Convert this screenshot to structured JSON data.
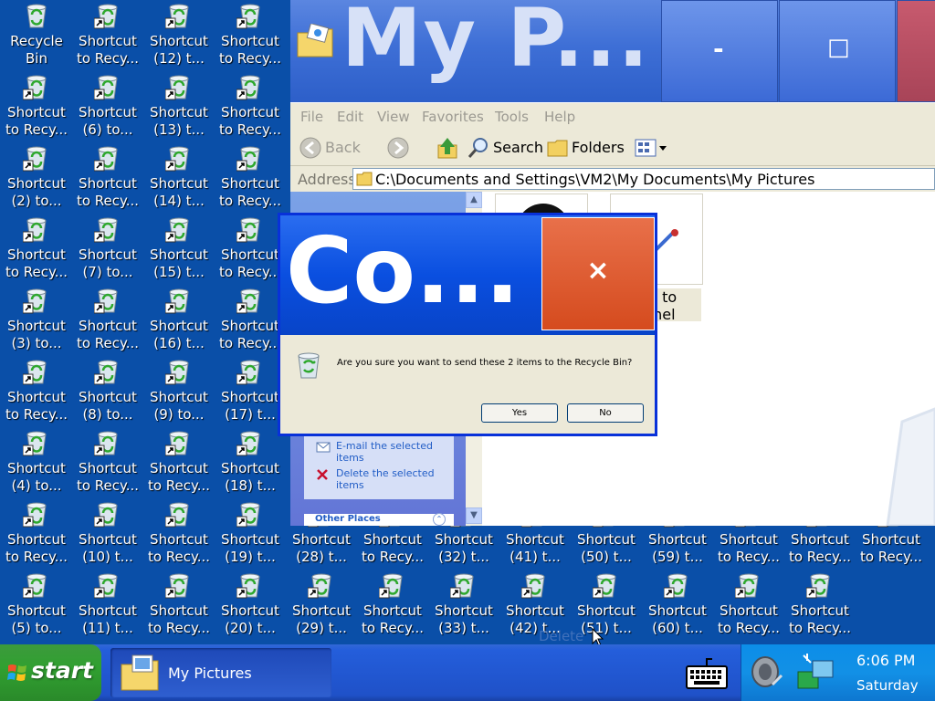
{
  "desktop": {
    "icons": [
      {
        "label1": "Recycle",
        "label2": "Bin"
      },
      {
        "label1": "Shortcut",
        "label2": "to Recy..."
      },
      {
        "label1": "Shortcut",
        "label2": "(12) t..."
      },
      {
        "label1": "Shortcut",
        "label2": "to Recy..."
      },
      {
        "label1": "Shortcut",
        "label2": "to Recy..."
      },
      {
        "label1": "Shortcut",
        "label2": "(6) to..."
      },
      {
        "label1": "Shortcut",
        "label2": "(13) t..."
      },
      {
        "label1": "Shortcut",
        "label2": "to Recy..."
      },
      {
        "label1": "Shortcut",
        "label2": "(2) to..."
      },
      {
        "label1": "Shortcut",
        "label2": "to Recy..."
      },
      {
        "label1": "Shortcut",
        "label2": "(14) t..."
      },
      {
        "label1": "Shortcut",
        "label2": "to Recy..."
      },
      {
        "label1": "Shortcut",
        "label2": "to Recy..."
      },
      {
        "label1": "Shortcut",
        "label2": "(7) to..."
      },
      {
        "label1": "Shortcut",
        "label2": "(15) t..."
      },
      {
        "label1": "Shortcut",
        "label2": "to Recy..."
      },
      {
        "label1": "Shortcut",
        "label2": "(3) to..."
      },
      {
        "label1": "Shortcut",
        "label2": "to Recy..."
      },
      {
        "label1": "Shortcut",
        "label2": "(16) t..."
      },
      {
        "label1": "Shortcut",
        "label2": "to Recy..."
      },
      {
        "label1": "Shortcut",
        "label2": "to Recy..."
      },
      {
        "label1": "Shortcut",
        "label2": "(8) to..."
      },
      {
        "label1": "Shortcut",
        "label2": "(9) to..."
      },
      {
        "label1": "Shortcut",
        "label2": "(17) t..."
      },
      {
        "label1": "Shortcut",
        "label2": "(4) to..."
      },
      {
        "label1": "Shortcut",
        "label2": "to Recy..."
      },
      {
        "label1": "Shortcut",
        "label2": "to Recy..."
      },
      {
        "label1": "Shortcut",
        "label2": "(18) t..."
      },
      {
        "label1": "Shortcut",
        "label2": "to Recy..."
      },
      {
        "label1": "Shortcut",
        "label2": "(10) t..."
      },
      {
        "label1": "Shortcut",
        "label2": "to Recy..."
      },
      {
        "label1": "Shortcut",
        "label2": "(19) t..."
      },
      {
        "label1": "Shortcut",
        "label2": "(28) t..."
      },
      {
        "label1": "Shortcut",
        "label2": "to Recy..."
      },
      {
        "label1": "Shortcut",
        "label2": "(32) t..."
      },
      {
        "label1": "Shortcut",
        "label2": "(41) t..."
      },
      {
        "label1": "Shortcut",
        "label2": "(50) t..."
      },
      {
        "label1": "Shortcut",
        "label2": "(59) t..."
      },
      {
        "label1": "Shortcut",
        "label2": "to Recy..."
      },
      {
        "label1": "Shortcut",
        "label2": "to Recy..."
      },
      {
        "label1": "Shortcut",
        "label2": "to Recy..."
      },
      {
        "label1": "Shortcut",
        "label2": "(5) to..."
      },
      {
        "label1": "Shortcut",
        "label2": "(11) t..."
      },
      {
        "label1": "Shortcut",
        "label2": "to Recy..."
      },
      {
        "label1": "Shortcut",
        "label2": "(20) t..."
      },
      {
        "label1": "Shortcut",
        "label2": "(29) t..."
      },
      {
        "label1": "Shortcut",
        "label2": "to Recy..."
      },
      {
        "label1": "Shortcut",
        "label2": "(33) t..."
      },
      {
        "label1": "Shortcut",
        "label2": "(42) t..."
      },
      {
        "label1": "Shortcut",
        "label2": "(51) t..."
      },
      {
        "label1": "Shortcut",
        "label2": "(60) t..."
      },
      {
        "label1": "Shortcut",
        "label2": "to Recy..."
      },
      {
        "label1": "Shortcut",
        "label2": "to Recy..."
      }
    ]
  },
  "explorer": {
    "title": "My P...",
    "minimize_glyph": "-",
    "maximize_glyph": "□",
    "menu": [
      "File",
      "Edit",
      "View",
      "Favorites",
      "Tools",
      "Help"
    ],
    "toolbar": {
      "back": "Back",
      "search": "Search",
      "folders": "Folders"
    },
    "address_label": "Address",
    "address_value": "C:\\Documents and Settings\\VM2\\My Documents\\My Pictures",
    "tasks": {
      "email": "E-mail the selected items",
      "delete": "Delete the selected items",
      "other_places": "Other Places"
    },
    "file_item_partial": [
      "cut to",
      "Panel"
    ]
  },
  "dialog": {
    "title": "Co...",
    "close_glyph": "×",
    "message": "Are you sure you want to send these 2 items to the Recycle Bin?",
    "yes_label": "Yes",
    "no_label": "No"
  },
  "drag_ghost_text": "Delete",
  "taskbar": {
    "start_label": "start",
    "task_label": "My Pictures",
    "time": "6:06 PM",
    "day": "Saturday"
  },
  "colors": {
    "desktop": "#0a4fa8",
    "title_blue": "#0a4fe0",
    "close_red": "#d54b1e",
    "start_green": "#31a031"
  }
}
